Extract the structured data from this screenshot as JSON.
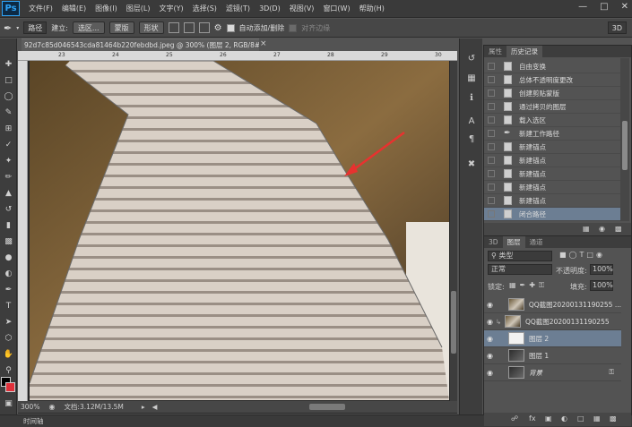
{
  "app": {
    "logo": "Ps"
  },
  "menu": {
    "items": [
      "文件(F)",
      "编辑(E)",
      "图像(I)",
      "图层(L)",
      "文字(Y)",
      "选择(S)",
      "滤镜(T)",
      "3D(D)",
      "视图(V)",
      "窗口(W)",
      "帮助(H)"
    ]
  },
  "options": {
    "mode": "路径",
    "build_label": "建立:",
    "selection_btn": "选区...",
    "mask_btn": "蒙版",
    "shape_btn": "形状",
    "auto_add_delete": "自动添加/删除",
    "align_edges": "对齐边缘",
    "btn_3d": "3D"
  },
  "document": {
    "tab_title": "92d7c85d046543cda81464b220febdbd.jpeg @ 300% (图层 2, RGB/8#) *",
    "zoom": "300%",
    "doc_size": "文档:3.12M/13.5M",
    "ruler_marks": [
      "23",
      "24",
      "25",
      "26",
      "27",
      "28",
      "29",
      "30"
    ]
  },
  "timeline": {
    "label": "时间轴"
  },
  "history": {
    "tabs": [
      "属性",
      "历史记录"
    ],
    "items": [
      "自由变换",
      "总体不透明度更改",
      "创建剪贴蒙版",
      "通过拷贝的图层",
      "载入选区",
      "新建工作路径",
      "新建锚点",
      "新建锚点",
      "新建锚点",
      "新建锚点",
      "新建锚点",
      "闭合路径"
    ],
    "selected_index": 11
  },
  "layers": {
    "tabs": [
      "3D",
      "图层",
      "通道"
    ],
    "filter": "类型",
    "blend_mode": "正常",
    "opacity_label": "不透明度:",
    "opacity_value": "100%",
    "lock_label": "锁定:",
    "fill_label": "填充:",
    "fill_value": "100%",
    "items": [
      {
        "name": "QQ截图20200131190255 ...",
        "thumb": "photo"
      },
      {
        "name": "QQ截图20200131190255",
        "thumb": "photo"
      },
      {
        "name": "图层 2",
        "thumb": "white"
      },
      {
        "name": "图层 1",
        "thumb": "photo"
      },
      {
        "name": "背景",
        "thumb": "photo"
      }
    ],
    "selected_index": 2
  },
  "colors": {
    "foreground": "#000000",
    "background": "#e0303a",
    "selection_highlight": "#6c7e93"
  }
}
